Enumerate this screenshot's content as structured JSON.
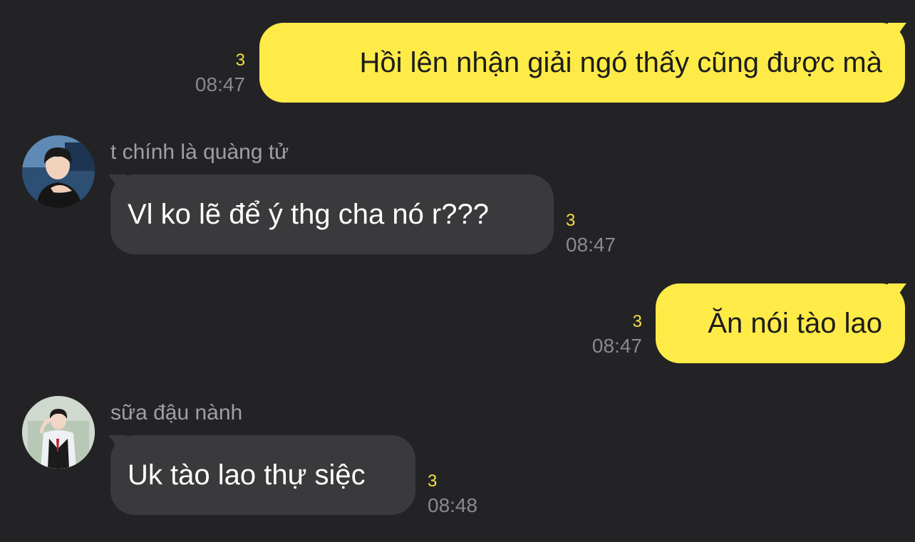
{
  "messages": [
    {
      "direction": "outgoing",
      "text": "Hồi lên nhận giải ngó thấy cũng được mà",
      "unread": "3",
      "time": "08:47"
    },
    {
      "direction": "incoming",
      "sender": "t chính là quàng tử",
      "avatar": "profile-photo",
      "text": "Vl ko lẽ để ý thg cha nó r???",
      "unread": "3",
      "time": "08:47"
    },
    {
      "direction": "outgoing",
      "text": "Ăn nói tào lao",
      "unread": "3",
      "time": "08:47"
    },
    {
      "direction": "incoming",
      "sender": "sữa đậu nành",
      "avatar": "profile-photo",
      "text": "Uk tào lao thự siệc",
      "unread": "3",
      "time": "08:48"
    }
  ],
  "colors": {
    "background": "#232325",
    "outgoing_bubble": "#FEEB47",
    "incoming_bubble": "#3A3A3D",
    "unread_count": "#F3E13F",
    "timestamp": "#8A8A8D",
    "sender_name": "#A0A0A3"
  }
}
